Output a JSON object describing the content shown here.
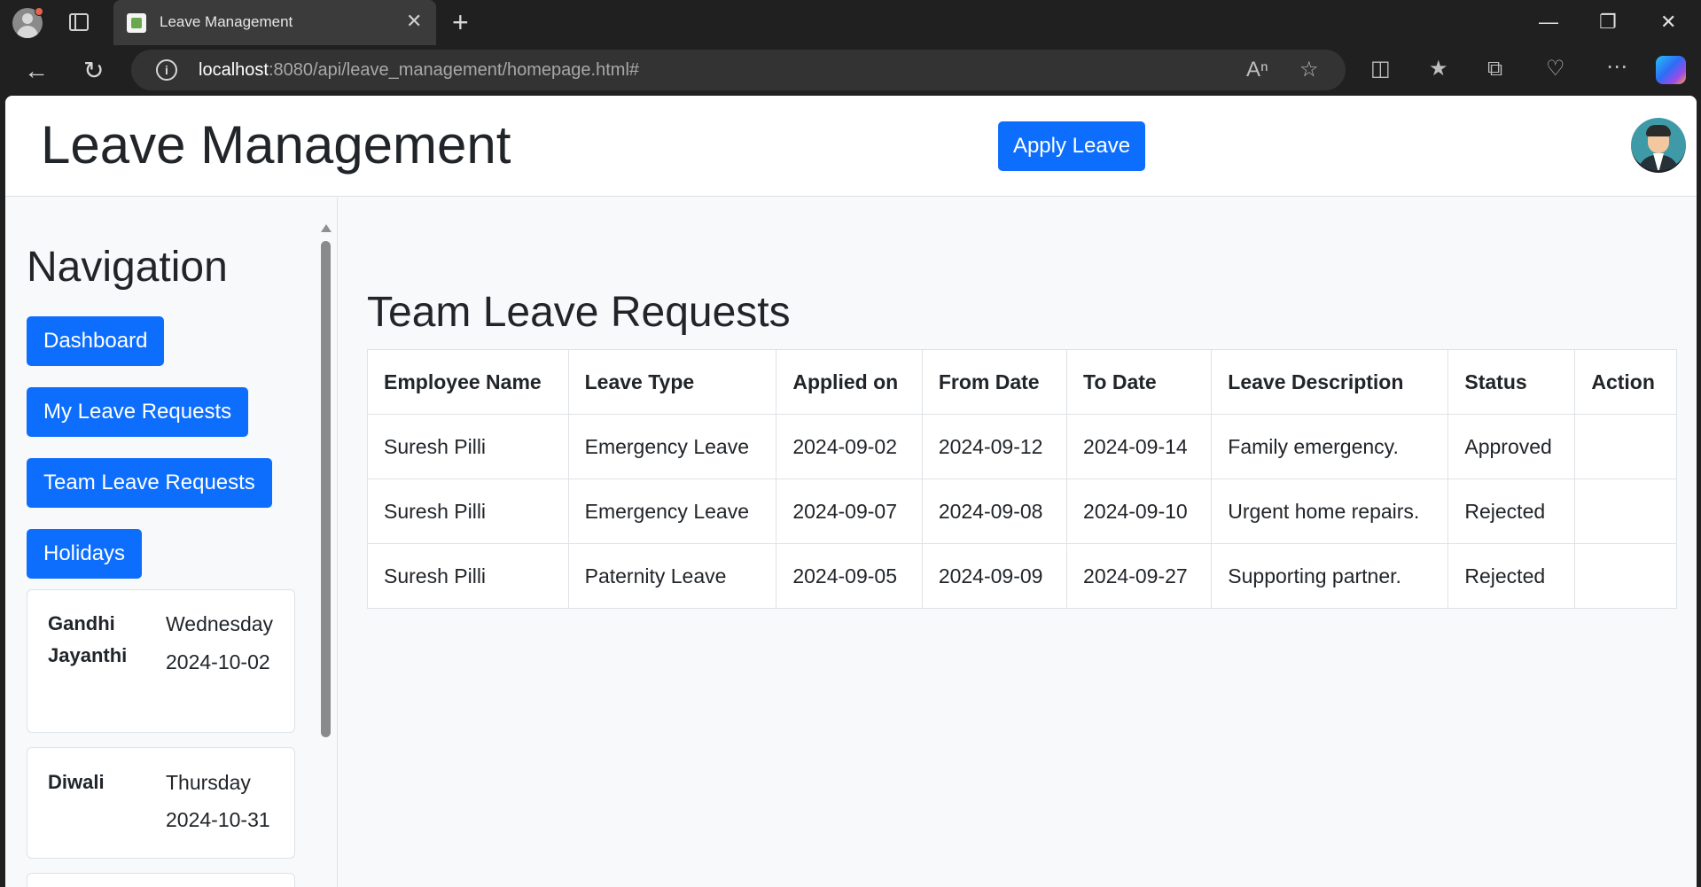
{
  "browser": {
    "tab_title": "Leave Management",
    "tab_close": "✕",
    "new_tab": "+",
    "url_host": "localhost",
    "url_path": ":8080/api/leave_management/homepage.html#",
    "window": {
      "minimize": "—",
      "restore": "❐",
      "close": "✕"
    }
  },
  "header": {
    "title": "Leave Management",
    "apply_button": "Apply Leave"
  },
  "sidebar": {
    "heading": "Navigation",
    "buttons": [
      "Dashboard",
      "My Leave Requests",
      "Team Leave Requests",
      "Holidays"
    ],
    "holidays": [
      {
        "name": "Gandhi Jayanthi",
        "day": "Wednesday",
        "date": "2024-10-02"
      },
      {
        "name": "Diwali",
        "day": "Thursday",
        "date": "2024-10-31"
      }
    ]
  },
  "main": {
    "heading": "Team Leave Requests",
    "columns": [
      "Employee Name",
      "Leave Type",
      "Applied on",
      "From Date",
      "To Date",
      "Leave Description",
      "Status",
      "Action"
    ],
    "rows": [
      [
        "Suresh Pilli",
        "Emergency Leave",
        "2024-09-02",
        "2024-09-12",
        "2024-09-14",
        "Family emergency.",
        "Approved",
        ""
      ],
      [
        "Suresh Pilli",
        "Emergency Leave",
        "2024-09-07",
        "2024-09-08",
        "2024-09-10",
        "Urgent home repairs.",
        "Rejected",
        ""
      ],
      [
        "Suresh Pilli",
        "Paternity Leave",
        "2024-09-05",
        "2024-09-09",
        "2024-09-27",
        "Supporting partner.",
        "Rejected",
        ""
      ]
    ]
  },
  "colors": {
    "primary": "#0d6efd",
    "page_bg": "#f8f9fa",
    "border": "#dee2e6",
    "browser_bg": "#202020"
  }
}
